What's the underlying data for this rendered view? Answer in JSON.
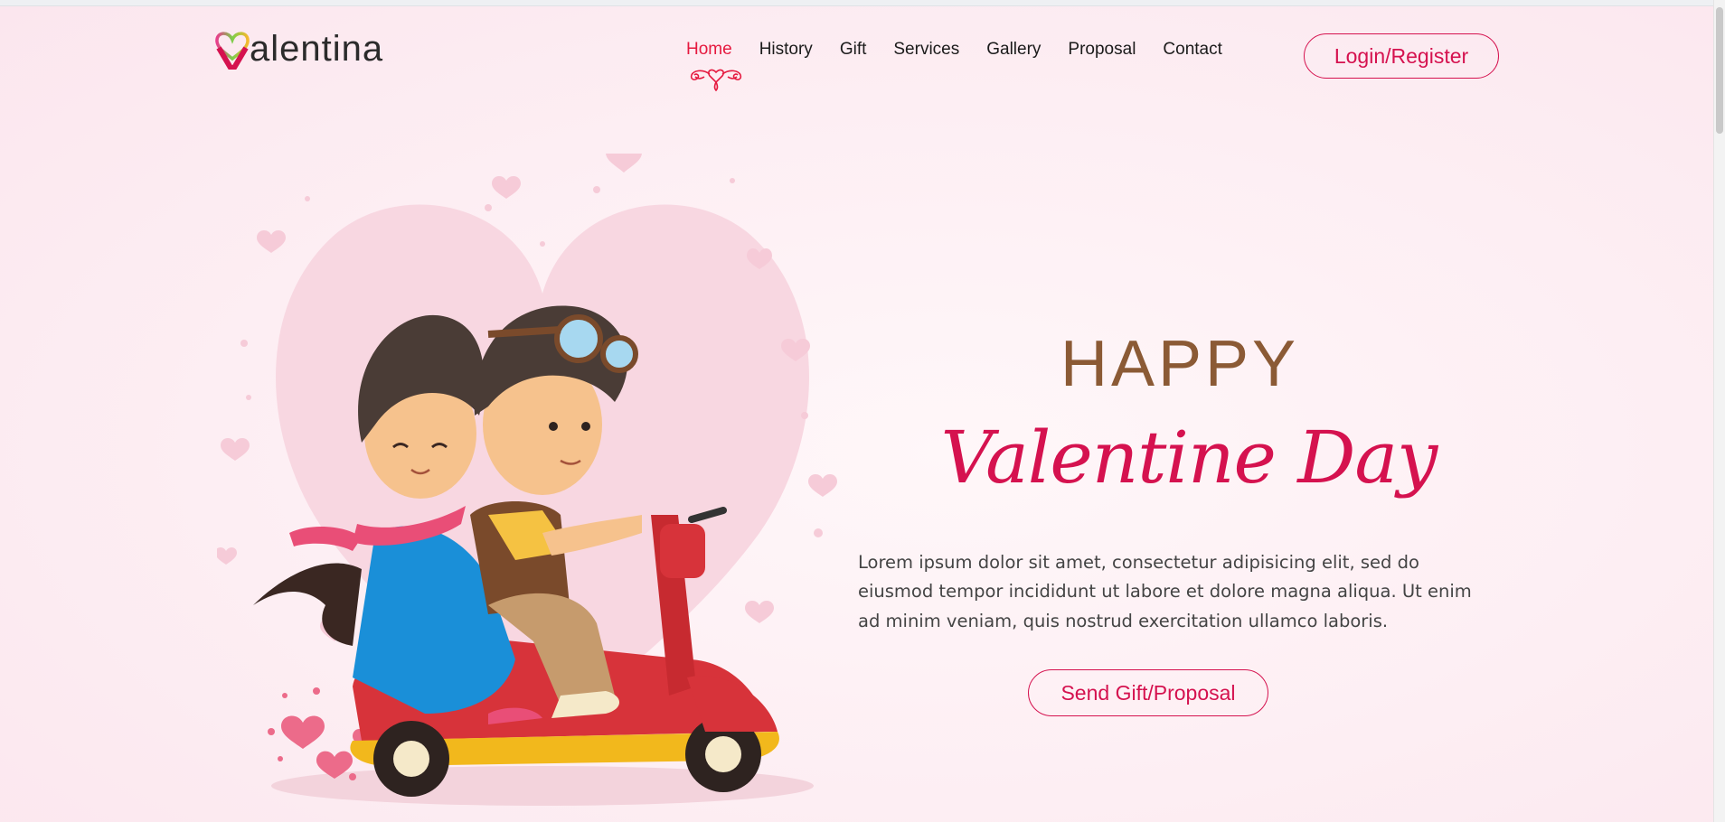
{
  "brand": {
    "name": "alentina",
    "logo_icon": "heart-v-icon"
  },
  "nav": {
    "items": [
      {
        "label": "Home",
        "active": true
      },
      {
        "label": "History",
        "active": false
      },
      {
        "label": "Gift",
        "active": false
      },
      {
        "label": "Services",
        "active": false
      },
      {
        "label": "Gallery",
        "active": false
      },
      {
        "label": "Proposal",
        "active": false
      },
      {
        "label": "Contact",
        "active": false
      }
    ],
    "active_ornament_icon": "heart-swirl-ornament-icon"
  },
  "auth": {
    "login_label": "Login/Register"
  },
  "hero": {
    "line1": "HAPPY",
    "line2": "Valentine Day",
    "description": "Lorem ipsum dolor sit amet, consectetur adipisicing elit, sed do eiusmod tempor incididunt ut labore et dolore magna aliqua. Ut enim ad minim veniam, quis nostrud exercitation ullamco laboris.",
    "cta_label": "Send Gift/Proposal",
    "illustration_icon": "couple-on-scooter-illustration"
  },
  "colors": {
    "accent": "#d5124f",
    "nav_active": "#e5193f",
    "heading_brown": "#8b5a35",
    "text": "#444444",
    "background": "#fdeef3"
  }
}
